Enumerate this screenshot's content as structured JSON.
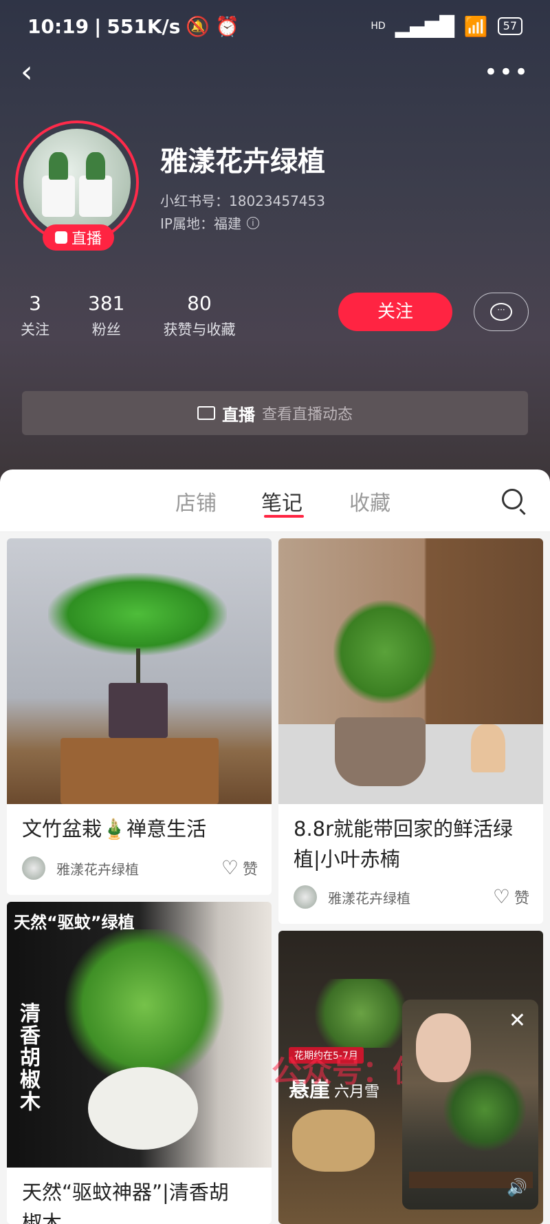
{
  "status_bar": {
    "time": "10:19",
    "speed": "551K/s",
    "network": "HD",
    "battery": "57"
  },
  "profile": {
    "name": "雅漾花卉绿植",
    "red_id": "小红书号：18023457453",
    "ip": "IP属地：福建",
    "live_badge": "直播",
    "stats": [
      {
        "value": "3",
        "label": "关注"
      },
      {
        "value": "381",
        "label": "粉丝"
      },
      {
        "value": "80",
        "label": "获赞与收藏"
      }
    ],
    "follow_label": "关注"
  },
  "live_bar": {
    "title": "直播",
    "subtitle": "查看直播动态"
  },
  "tabs": [
    {
      "label": "店铺"
    },
    {
      "label": "笔记"
    },
    {
      "label": "收藏"
    }
  ],
  "active_tab": "笔记",
  "notes": [
    {
      "title": "文竹盆栽🎍禅意生活",
      "author": "雅漾花卉绿植",
      "like_label": "赞"
    },
    {
      "title_line1": "8.8r就能带回家的鲜活绿",
      "title_line2": "植|小叶赤楠",
      "author": "雅漾花卉绿植",
      "like_label": "赞"
    },
    {
      "overlay": "天然“驱蚊”绿植",
      "vertical": "清香胡椒木",
      "title_line1": "天然“驱蚊神器”|清香胡",
      "title_line2": "椒木"
    },
    {
      "badge": "花期约在5-7月",
      "overlay_main": "悬崖",
      "overlay_sub": "六月雪",
      "watermark": "公众号：优创笔记"
    }
  ],
  "icons": [
    "back-icon",
    "more-icon",
    "info-icon",
    "message-icon",
    "camera-icon",
    "search-icon",
    "heart-icon",
    "close-icon",
    "sound-icon"
  ],
  "colors": {
    "accent": "#ff2442",
    "header_bg": "#3d3e4c"
  }
}
